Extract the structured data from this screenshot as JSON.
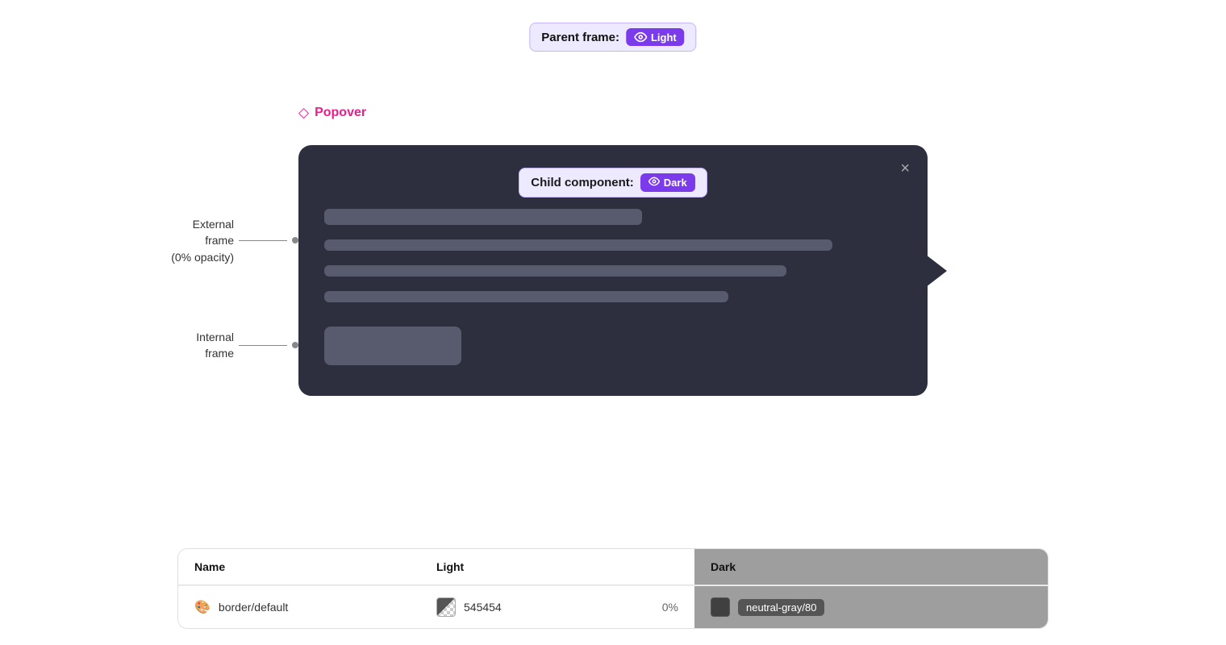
{
  "parent_frame": {
    "label": "Parent frame:",
    "theme": "Light",
    "badge_bg": "#ede9fe",
    "badge_border": "#c4b5fd",
    "pill_bg": "#7c3aed"
  },
  "popover_label": "Popover",
  "annotations": {
    "external": "External\nframe\n(0% opacity)",
    "internal": "Internal\nframe"
  },
  "child_component": {
    "label": "Child component:",
    "theme": "Dark"
  },
  "close_icon": "×",
  "table": {
    "headers": [
      "Name",
      "Light",
      "Dark"
    ],
    "row": {
      "name": "border/default",
      "light_hex": "545454",
      "light_opacity": "0%",
      "dark_token": "neutral-gray/80"
    }
  }
}
